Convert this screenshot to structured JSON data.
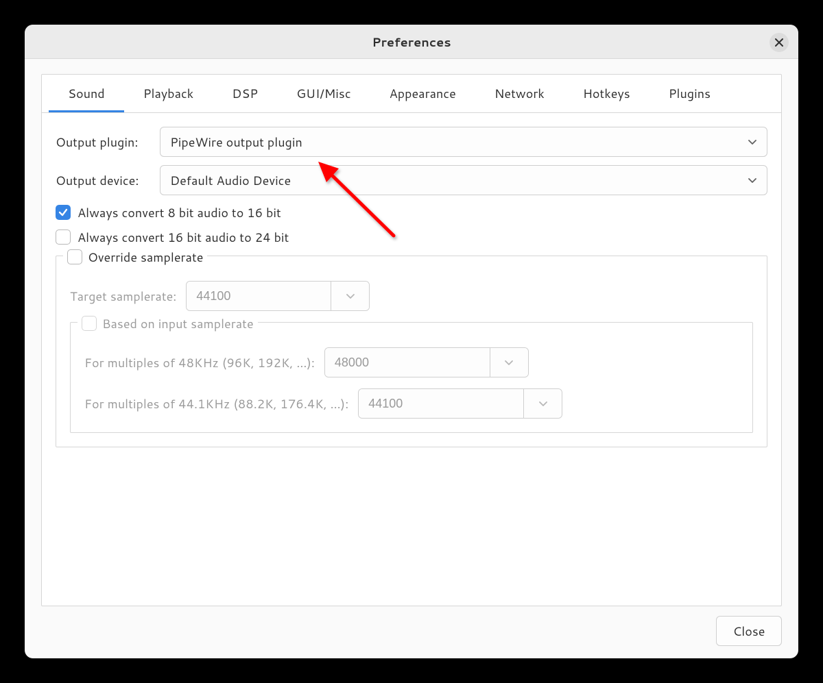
{
  "window": {
    "title": "Preferences"
  },
  "tabs": [
    "Sound",
    "Playback",
    "DSP",
    "GUI/Misc",
    "Appearance",
    "Network",
    "Hotkeys",
    "Plugins"
  ],
  "active_tab": 0,
  "sound": {
    "output_plugin_label": "Output plugin:",
    "output_plugin_value": "PipeWire output plugin",
    "output_device_label": "Output device:",
    "output_device_value": "Default Audio Device",
    "convert_8_to_16_label": "Always convert 8 bit audio to 16 bit",
    "convert_8_to_16_checked": true,
    "convert_16_to_24_label": "Always convert 16 bit audio to 24 bit",
    "convert_16_to_24_checked": false,
    "override_sr_label": "Override samplerate",
    "override_sr_checked": false,
    "target_sr_label": "Target samplerate:",
    "target_sr_value": "44100",
    "based_on_input_label": "Based on input samplerate",
    "based_on_input_checked": false,
    "mult_48_label": "For multiples of 48KHz (96K, 192K, ...):",
    "mult_48_value": "48000",
    "mult_441_label": "For multiples of 44.1KHz (88.2K, 176.4K, ...):",
    "mult_441_value": "44100"
  },
  "footer": {
    "close_label": "Close"
  },
  "annotation": {
    "arrow_color": "#ff0000"
  }
}
